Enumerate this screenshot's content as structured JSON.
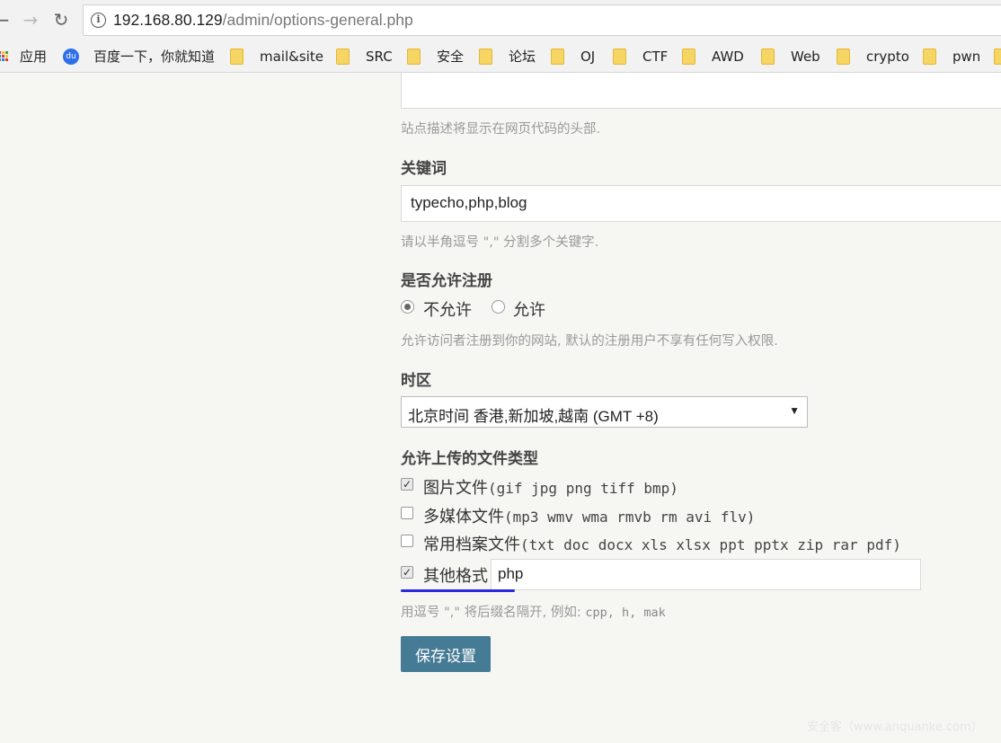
{
  "browser": {
    "back_icon": "back-arrow-icon",
    "forward_icon": "forward-arrow-icon",
    "reload_icon": "reload-icon",
    "url_host": "192.168.80.129",
    "url_path": "/admin/options-general.php",
    "bookmarks": [
      {
        "label": "应用",
        "icon": "apps-icon"
      },
      {
        "label": "百度一下，你就知道",
        "icon": "baidu-icon"
      },
      {
        "label": "mail&site",
        "icon": "folder-icon"
      },
      {
        "label": "SRC",
        "icon": "folder-icon"
      },
      {
        "label": "安全",
        "icon": "folder-icon"
      },
      {
        "label": "论坛",
        "icon": "folder-icon"
      },
      {
        "label": "OJ",
        "icon": "folder-icon"
      },
      {
        "label": "CTF",
        "icon": "folder-icon"
      },
      {
        "label": "AWD",
        "icon": "folder-icon"
      },
      {
        "label": "Web",
        "icon": "folder-icon"
      },
      {
        "label": "crypto",
        "icon": "folder-icon"
      },
      {
        "label": "pwn",
        "icon": "folder-icon"
      }
    ]
  },
  "form": {
    "description": {
      "hint": "站点描述将显示在网页代码的头部."
    },
    "keywords": {
      "label": "关键词",
      "value": "typecho,php,blog",
      "hint": "请以半角逗号 \",\" 分割多个关键字."
    },
    "register": {
      "label": "是否允许注册",
      "options": [
        {
          "label": "不允许",
          "checked": true
        },
        {
          "label": "允许",
          "checked": false
        }
      ],
      "hint": "允许访问者注册到你的网站, 默认的注册用户不享有任何写入权限."
    },
    "timezone": {
      "label": "时区",
      "selected": "北京时间 香港,新加坡,越南 (GMT +8)"
    },
    "upload_types": {
      "label": "允许上传的文件类型",
      "options": [
        {
          "label": "图片文件",
          "detail": "(gif jpg png tiff bmp)",
          "checked": true
        },
        {
          "label": "多媒体文件",
          "detail": "(mp3 wmv wma rmvb rm avi flv)",
          "checked": false
        },
        {
          "label": "常用档案文件",
          "detail": "(txt doc docx xls xlsx ppt pptx zip rar pdf)",
          "checked": false
        }
      ],
      "other": {
        "label": "其他格式",
        "checked": true,
        "value": "php"
      },
      "hint_prefix": "用逗号 \",\" 将后缀名隔开, 例如: ",
      "hint_example": "cpp, h, mak"
    },
    "save_label": "保存设置"
  },
  "watermark": "安全客（www.anquanke.com）",
  "colors": {
    "button": "#467b96",
    "underline": "#2a2adf"
  }
}
